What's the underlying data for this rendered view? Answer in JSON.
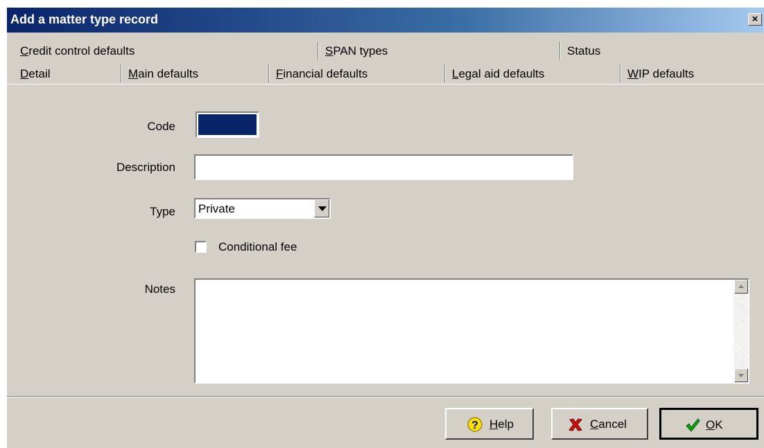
{
  "window": {
    "title": "Add a matter type record",
    "close_glyph": "×"
  },
  "tabs_row1": [
    {
      "label": "Credit control defaults",
      "mnemonic": "C",
      "rest": "redit control defaults"
    },
    {
      "label": "SPAN types",
      "mnemonic": "S",
      "rest": "PAN types"
    },
    {
      "label": "Status",
      "mnemonic": "",
      "rest": "Status"
    }
  ],
  "tabs_row2": [
    {
      "label": "Detail",
      "mnemonic": "D",
      "rest": "etail",
      "active": true
    },
    {
      "label": "Main defaults",
      "mnemonic": "M",
      "rest": "ain defaults"
    },
    {
      "label": "Financial defaults",
      "mnemonic": "F",
      "rest": "inancial defaults"
    },
    {
      "label": "Legal aid defaults",
      "mnemonic": "L",
      "rest": "egal aid defaults"
    },
    {
      "label": "WIP defaults",
      "mnemonic": "W",
      "rest": "IP defaults"
    }
  ],
  "form": {
    "code_label": "Code",
    "code_value": "",
    "description_label": "Description",
    "description_value": "",
    "type_label": "Type",
    "type_value": "Private",
    "conditional_fee_label": "Conditional fee",
    "conditional_fee_checked": false,
    "notes_label": "Notes",
    "notes_value": ""
  },
  "buttons": {
    "help": {
      "mnemonic": "H",
      "rest": "elp"
    },
    "cancel": {
      "mnemonic": "C",
      "rest": "ancel"
    },
    "ok": {
      "mnemonic": "O",
      "rest": "K"
    }
  },
  "icons": {
    "help": "question-icon",
    "cancel": "red-x-icon",
    "ok": "green-check-icon"
  },
  "colors": {
    "title_start": "#0a246a",
    "face": "#d4d0c8",
    "selection": "#0a246a"
  }
}
